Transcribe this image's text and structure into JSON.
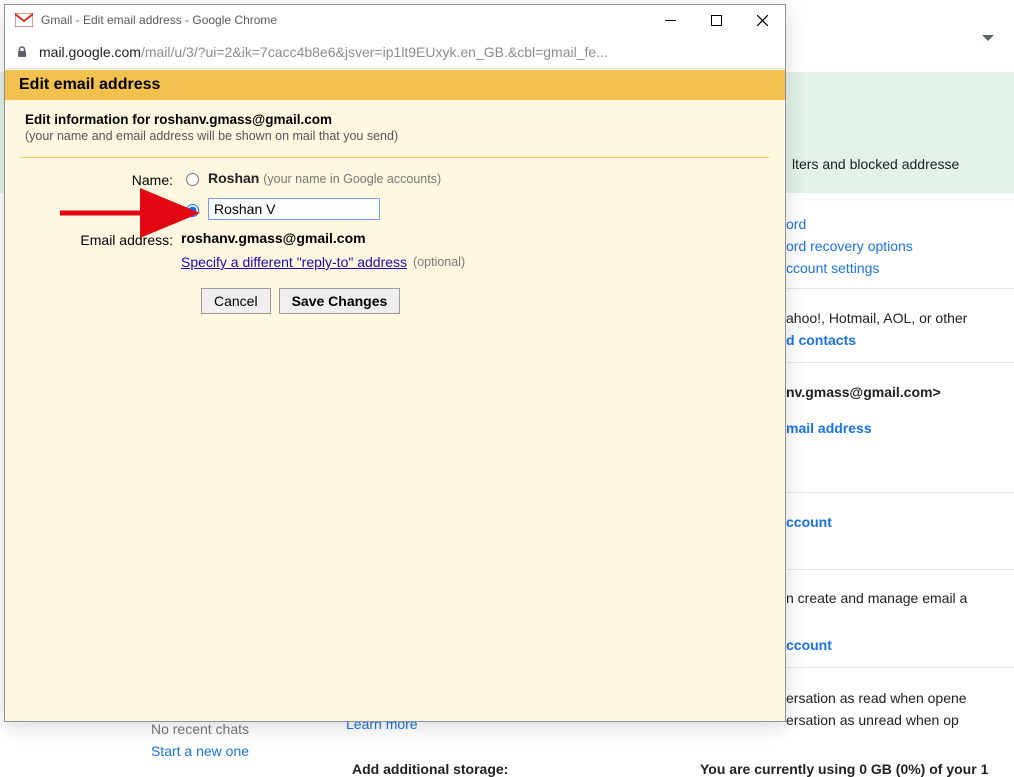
{
  "window": {
    "title": "Gmail - Edit email address - Google Chrome",
    "url_host": "mail.google.com",
    "url_path": "/mail/u/3/?ui=2&ik=7cacc4b8e6&jsver=ip1lt9EUxyk.en_GB.&cbl=gmail_fe..."
  },
  "dialog": {
    "title": "Edit email address",
    "info_title": "Edit information for roshanv.gmass@gmail.com",
    "info_sub": "(your name and email address will be shown on mail that you send)",
    "labels": {
      "name": "Name:",
      "email": "Email address:"
    },
    "name_option_default": "Roshan",
    "name_option_hint": "(your name in Google accounts)",
    "name_custom_value": "Roshan V",
    "email_value": "roshanv.gmass@gmail.com",
    "replyto_link": "Specify a different \"reply-to\" address",
    "optional_hint": "(optional)",
    "buttons": {
      "cancel": "Cancel",
      "save": "Save Changes"
    }
  },
  "bg": {
    "filters_tab": "lters and blocked addresse",
    "l1": "ord",
    "l2": "ord recovery options",
    "l3": "ccount settings",
    "l4": "ahoo!, Hotmail, AOL, or other",
    "l5": "d contacts",
    "l6": "nv.gmass@gmail.com>",
    "l7": "mail address",
    "l8": "ccount",
    "l9": "n create and manage email a",
    "l10": "ccount",
    "l11": "ersation as read when opene",
    "l12": "ersation as unread when op",
    "chat_empty": "No recent chats",
    "chat_start": "Start a new one",
    "learn_more": "Learn more",
    "add_storage": "Add additional storage:",
    "storage_info": "You are currently using 0 GB (0%) of your 1"
  }
}
